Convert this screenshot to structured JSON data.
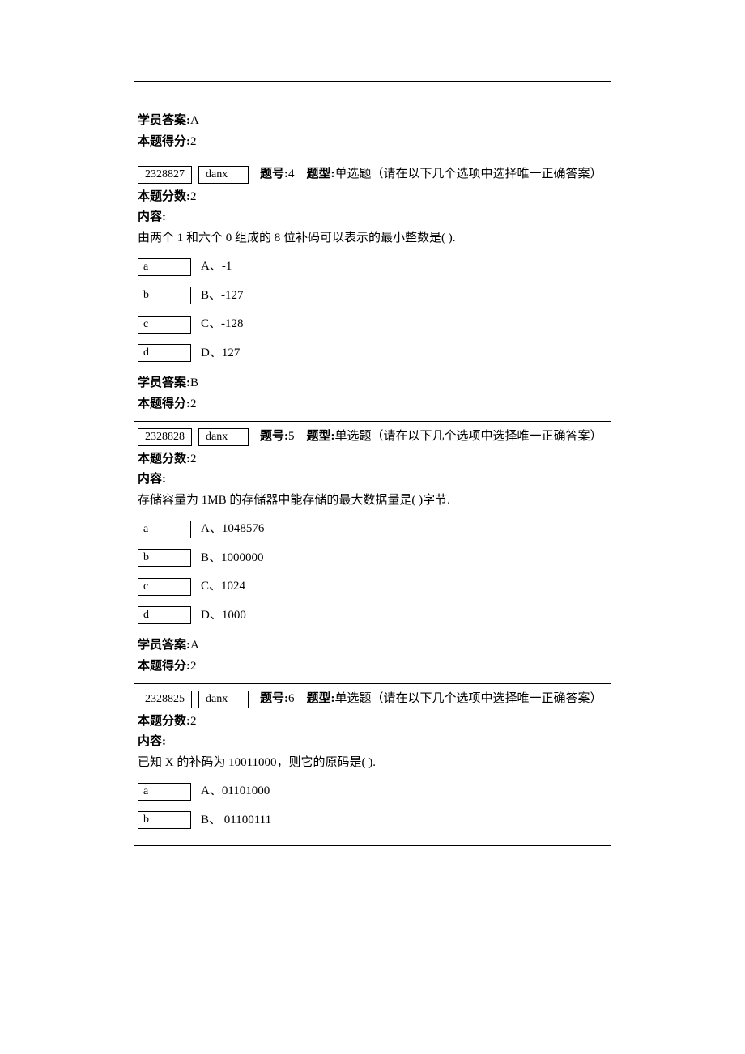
{
  "labels": {
    "student_answer": "学员答案:",
    "score_earned": "本题得分:",
    "qnum_label": "题号:",
    "qtype_label": "题型:",
    "max_score_label": "本题分数:",
    "content_label": "内容:",
    "qtype_desc": "单选题（请在以下几个选项中选择唯一正确答案）"
  },
  "cell_top": {
    "student_answer": "A",
    "score_earned": "2"
  },
  "q4": {
    "box1": "2328827",
    "box2": "danx",
    "qnum": "4",
    "max_score": "2",
    "content": "由两个 1 和六个 0 组成的 8 位补码可以表示的最小整数是( ).",
    "options": [
      {
        "box": "a",
        "text": "A、-1"
      },
      {
        "box": "b",
        "text": "B、-127"
      },
      {
        "box": "c",
        "text": "C、-128"
      },
      {
        "box": "d",
        "text": "D、127"
      }
    ],
    "student_answer": "B",
    "score_earned": "2"
  },
  "q5": {
    "box1": "2328828",
    "box2": "danx",
    "qnum": "5",
    "max_score": "2",
    "content": "存储容量为 1MB 的存储器中能存储的最大数据量是( )字节.",
    "options": [
      {
        "box": "a",
        "text": "A、1048576"
      },
      {
        "box": "b",
        "text": "B、1000000"
      },
      {
        "box": "c",
        "text": "C、1024"
      },
      {
        "box": "d",
        "text": "D、1000"
      }
    ],
    "student_answer": "A",
    "score_earned": "2"
  },
  "q6": {
    "box1": "2328825",
    "box2": "danx",
    "qnum": "6",
    "max_score": "2",
    "content": "已知 X 的补码为 10011000，则它的原码是( ).",
    "options": [
      {
        "box": "a",
        "text": "A、01101000"
      },
      {
        "box": "b",
        "text": "B、  01100111"
      }
    ]
  }
}
